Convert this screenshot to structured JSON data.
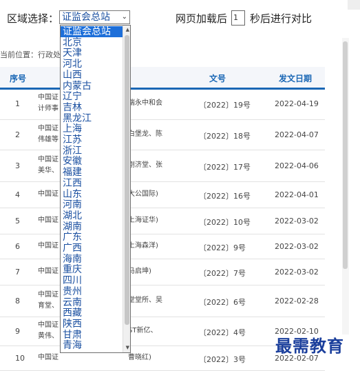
{
  "toolbar": {
    "region_label": "区域选择：",
    "selected_region": "证监会总站",
    "load_label": "网页加载后",
    "seconds_value": "1",
    "seconds_suffix": "秒后进行对比"
  },
  "breadcrumb": "当前位置：行政处",
  "table": {
    "headers": {
      "no": "序号",
      "docno": "文号",
      "date": "发文日期"
    },
    "rows": [
      {
        "no": "1",
        "unit": [
          "中国证",
          "计师事"
        ],
        "title": [
          "瑞永中和会"
        ],
        "docno": "〔2022〕19号",
        "date": "2022-04-19"
      },
      {
        "no": "2",
        "unit": [
          "中国证",
          "伟雄等"
        ],
        "title": [
          "白堡龙、陈"
        ],
        "docno": "〔2022〕18号",
        "date": "2022-04-07"
      },
      {
        "no": "3",
        "unit": [
          "中国证",
          "美华、"
        ],
        "title": [
          "刚济堂、张"
        ],
        "docno": "〔2022〕17号",
        "date": "2022-04-06"
      },
      {
        "no": "4",
        "unit": [
          "中国证"
        ],
        "title": [
          "大公国际)"
        ],
        "docno": "〔2022〕16号",
        "date": "2022-04-01"
      },
      {
        "no": "5",
        "unit": [
          "中国证"
        ],
        "title": [
          "上海证华)"
        ],
        "docno": "〔2022〕10号",
        "date": "2022-03-02"
      },
      {
        "no": "6",
        "unit": [
          "中国证"
        ],
        "title": [
          "上海森洋)"
        ],
        "docno": "〔2022〕9号",
        "date": "2022-03-02"
      },
      {
        "no": "7",
        "unit": [
          "中国证"
        ],
        "title": [
          "马启坤)"
        ],
        "docno": "〔2022〕7号",
        "date": "2022-03-02"
      },
      {
        "no": "8",
        "unit": [
          "中国证",
          "育堂、"
        ],
        "title": [
          "堂堂所、吴"
        ],
        "docno": "〔2022〕6号",
        "date": "2022-02-28"
      },
      {
        "no": "9",
        "unit": [
          "中国证",
          "黄伟、"
        ],
        "title": [
          "ST新亿、"
        ],
        "docno": "〔2022〕4号",
        "date": "2022-02-10"
      },
      {
        "no": "10",
        "unit": [
          "中国证"
        ],
        "title": [
          "曹晓红)"
        ],
        "docno": "〔2022〕3号",
        "date": "2022-02-07"
      }
    ]
  },
  "dropdown_options": [
    "证监会总站",
    "北京",
    "天津",
    "河北",
    "山西",
    "内蒙古",
    "辽宁",
    "吉林",
    "黑龙江",
    "上海",
    "江苏",
    "浙江",
    "安徽",
    "福建",
    "江西",
    "山东",
    "河南",
    "湖北",
    "湖南",
    "广东",
    "广西",
    "海南",
    "重庆",
    "四川",
    "贵州",
    "云南",
    "西藏",
    "陕西",
    "甘肃",
    "青海"
  ],
  "watermark": "最需教育"
}
